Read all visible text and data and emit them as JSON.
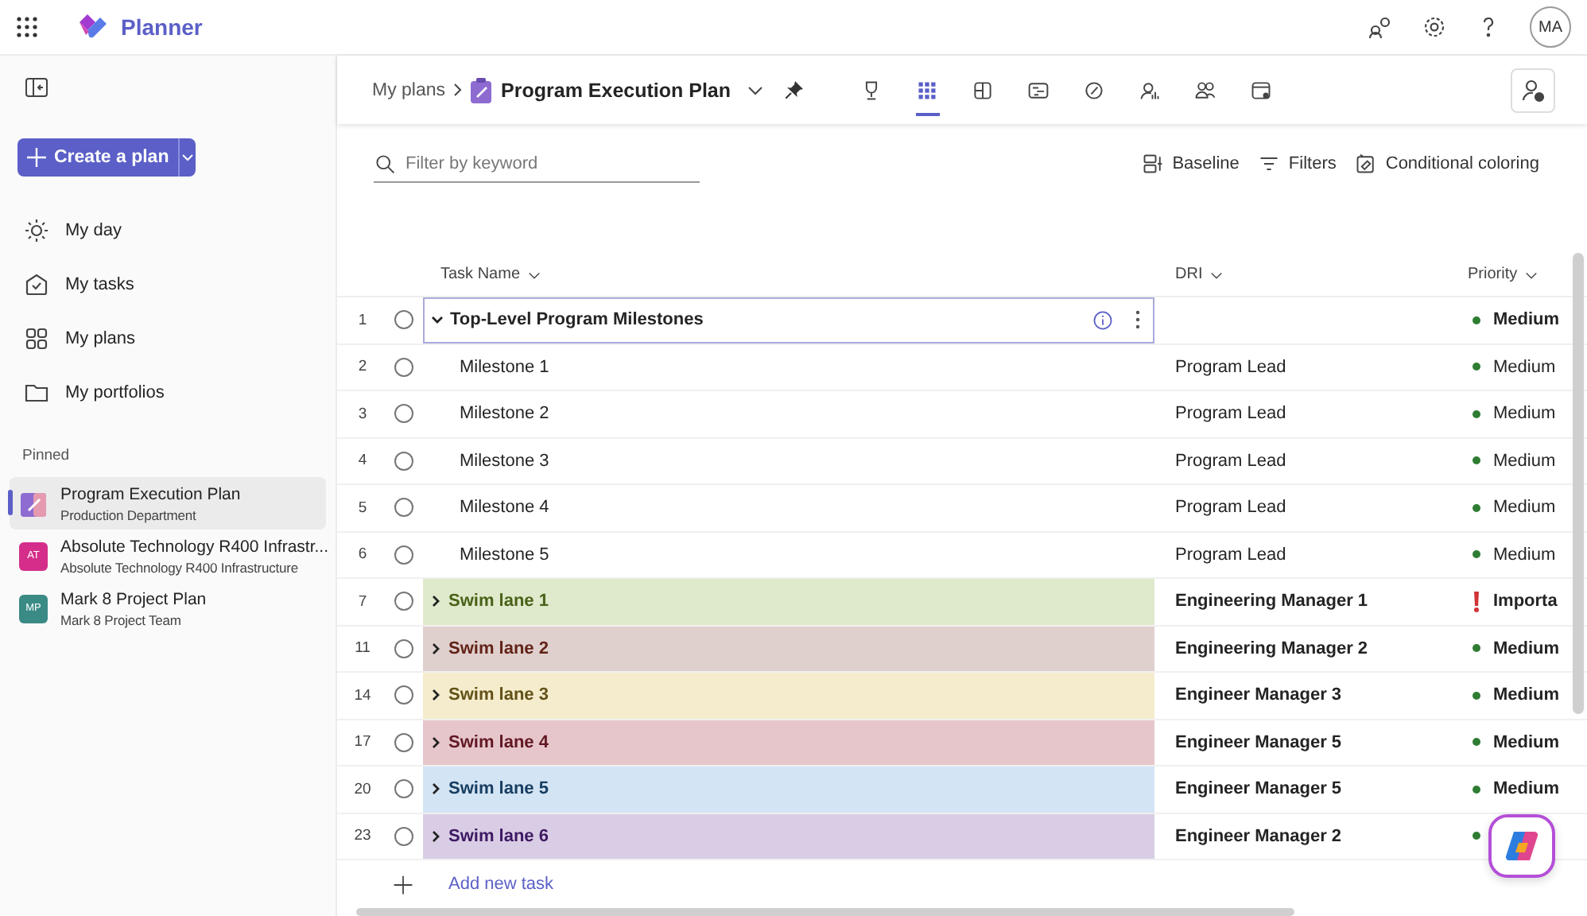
{
  "app": {
    "name": "Planner",
    "avatar": "MA"
  },
  "sidebar": {
    "create_button": "Create a plan",
    "nav": [
      {
        "kind": "day",
        "label": "My day"
      },
      {
        "kind": "tasks",
        "label": "My tasks"
      },
      {
        "kind": "plans",
        "label": "My plans"
      },
      {
        "kind": "portfolios",
        "label": "My portfolios"
      }
    ],
    "pinned_label": "Pinned",
    "pinned": [
      {
        "kind": "plan-icon",
        "name": "Program Execution Plan",
        "subtitle": "Production Department",
        "selected": true
      },
      {
        "kind": "initials",
        "initials": "AT",
        "color": "#d42e8a",
        "name": "Absolute Technology R400 Infrastr...",
        "subtitle": "Absolute Technology R400 Infrastructure",
        "selected": false
      },
      {
        "kind": "initials",
        "initials": "MP",
        "color": "#3a8a85",
        "name": "Mark 8 Project Plan",
        "subtitle": "Mark 8 Project Team",
        "selected": false
      }
    ]
  },
  "header": {
    "breadcrumb": "My plans",
    "plan_title": "Program Execution Plan",
    "views": [
      {
        "kind": "goals",
        "selected": false
      },
      {
        "kind": "grid",
        "selected": true
      },
      {
        "kind": "board",
        "selected": false
      },
      {
        "kind": "timeline",
        "selected": false
      },
      {
        "kind": "charts",
        "selected": false
      },
      {
        "kind": "people",
        "selected": false
      },
      {
        "kind": "assignments",
        "selected": false
      },
      {
        "kind": "schedule",
        "selected": false
      }
    ]
  },
  "toolbar": {
    "search": {
      "placeholder": "Filter by keyword"
    },
    "actions": [
      {
        "kind": "baseline",
        "label": "Baseline"
      },
      {
        "kind": "filters",
        "label": "Filters"
      },
      {
        "kind": "coloring",
        "label": "Conditional coloring"
      }
    ]
  },
  "table": {
    "columns": [
      "Task Name",
      "DRI",
      "Priority"
    ],
    "rows": [
      {
        "num": "1",
        "kind": "summary",
        "expanded": true,
        "selected": true,
        "checked": false,
        "name": "Top-Level Program Milestones",
        "priority": {
          "kind": "medium",
          "label": "Medium"
        }
      },
      {
        "num": "2",
        "kind": "task",
        "selected": false,
        "checked": false,
        "name": "Milestone 1",
        "dri": "Program Lead",
        "priority": {
          "kind": "medium",
          "label": "Medium"
        }
      },
      {
        "num": "3",
        "kind": "task",
        "selected": false,
        "checked": false,
        "name": "Milestone 2",
        "dri": "Program Lead",
        "priority": {
          "kind": "medium",
          "label": "Medium"
        }
      },
      {
        "num": "4",
        "kind": "task",
        "selected": false,
        "checked": false,
        "name": "Milestone 3",
        "dri": "Program Lead",
        "priority": {
          "kind": "medium",
          "label": "Medium"
        }
      },
      {
        "num": "5",
        "kind": "task",
        "selected": false,
        "checked": false,
        "name": "Milestone 4",
        "dri": "Program Lead",
        "priority": {
          "kind": "medium",
          "label": "Medium"
        }
      },
      {
        "num": "6",
        "kind": "task",
        "selected": false,
        "checked": false,
        "name": "Milestone 5",
        "dri": "Program Lead",
        "priority": {
          "kind": "medium",
          "label": "Medium"
        }
      },
      {
        "num": "7",
        "kind": "lane",
        "expanded": false,
        "selected": false,
        "checked": false,
        "color": "#dfe9cb",
        "name": "Swim lane 1",
        "dri": "Engineering Manager 1",
        "priority": {
          "kind": "important",
          "label": "Importa"
        }
      },
      {
        "num": "11",
        "kind": "lane",
        "expanded": false,
        "selected": false,
        "checked": false,
        "color": "#e0d0cd",
        "name": "Swim lane 2",
        "dri": "Engineering Manager 2",
        "priority": {
          "kind": "medium",
          "label": "Medium"
        }
      },
      {
        "num": "14",
        "kind": "lane",
        "expanded": false,
        "selected": false,
        "checked": false,
        "color": "#f5eccd",
        "name": "Swim lane 3",
        "dri": "Engineer Manager 3",
        "priority": {
          "kind": "medium",
          "label": "Medium"
        }
      },
      {
        "num": "17",
        "kind": "lane",
        "expanded": false,
        "selected": false,
        "checked": false,
        "color": "#e6c6cb",
        "name": "Swim lane 4",
        "dri": "Engineer Manager 5",
        "priority": {
          "kind": "medium",
          "label": "Medium"
        }
      },
      {
        "num": "20",
        "kind": "lane",
        "expanded": false,
        "selected": false,
        "checked": false,
        "color": "#d3e4f4",
        "name": "Swim lane 5",
        "dri": "Engineer Manager 5",
        "priority": {
          "kind": "medium",
          "label": "Medium"
        }
      },
      {
        "num": "23",
        "kind": "lane",
        "expanded": false,
        "selected": false,
        "checked": false,
        "color": "#d9cde5",
        "name": "Swim lane 6",
        "dri": "Engineer Manager 2",
        "priority": {
          "kind": "medium"
        }
      }
    ],
    "add_task": "Add new task"
  }
}
